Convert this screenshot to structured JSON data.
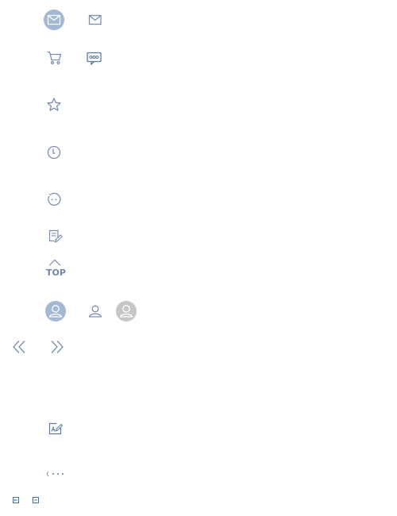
{
  "colors": {
    "icon_stroke": "#7a8fae",
    "icon_fill_bg": "#a3b8d4",
    "avatar_gray": "#c6c6c6",
    "tiny_icon": "#3d6ea8"
  },
  "icons": [
    "mail-filled-icon",
    "mail-icon",
    "cart-icon",
    "chat-bubble-icon",
    "star-icon",
    "clock-icon",
    "face-icon",
    "edit-note-icon",
    "back-to-top-icon",
    "user-avatar-filled-icon",
    "user-icon",
    "user-avatar-gray-icon",
    "double-chevron-left-icon",
    "double-chevron-right-icon",
    "signature-icon",
    "more-dots-icon",
    "expand-box-icon",
    "collapse-box-icon"
  ],
  "top_button": {
    "label": "TOP"
  }
}
